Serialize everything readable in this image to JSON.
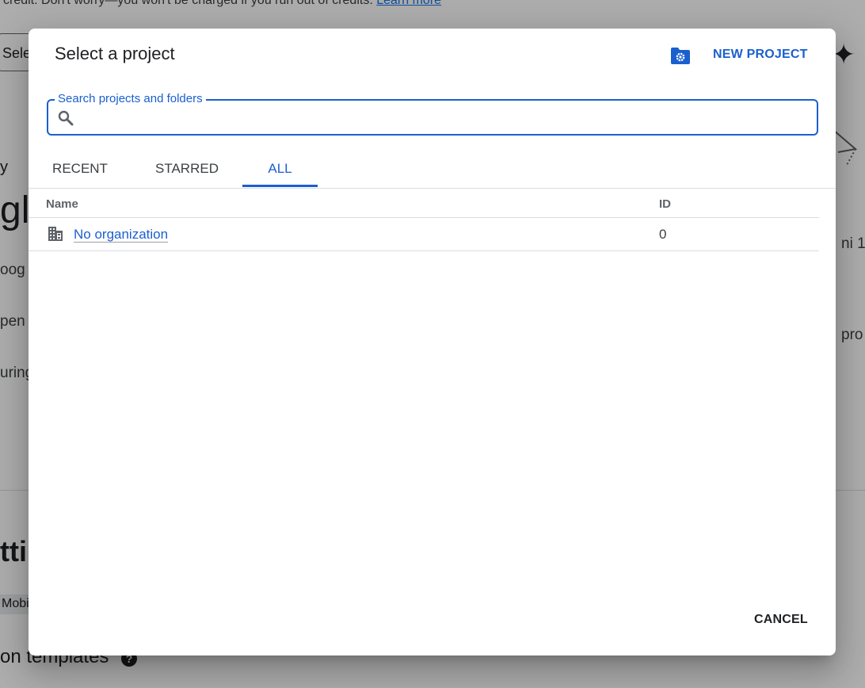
{
  "background": {
    "banner_text": "credit. Don't worry—you won't be charged if you run out of credits.",
    "banner_link": "Learn more",
    "select_button_label": "Sele",
    "fragment_y": "y",
    "fragment_big": "gl",
    "fragment_goog": "oog",
    "fragment_pen": "pen",
    "fragment_uring": "uring",
    "fragment_tti": "tti",
    "fragment_chip": "Mobi",
    "fragment_templates": "on templates",
    "fragment_ni": "ni 1.",
    "fragment_pro": "pro"
  },
  "dialog": {
    "title": "Select a project",
    "new_project_icon": "folder-settings-icon",
    "new_project_label": "NEW PROJECT",
    "search": {
      "label": "Search projects and folders",
      "value": "",
      "placeholder": ""
    },
    "tabs": [
      {
        "label": "RECENT",
        "active": false
      },
      {
        "label": "STARRED",
        "active": false
      },
      {
        "label": "ALL",
        "active": true
      }
    ],
    "table": {
      "columns": [
        "Name",
        "ID"
      ],
      "rows": [
        {
          "icon": "organization-icon",
          "name": "No organization",
          "id": "0"
        }
      ]
    },
    "cancel_label": "CANCEL"
  },
  "colors": {
    "accent": "#1a5fcf",
    "scrim": "rgba(0,0,0,0.32)",
    "divider": "#dadce0"
  }
}
